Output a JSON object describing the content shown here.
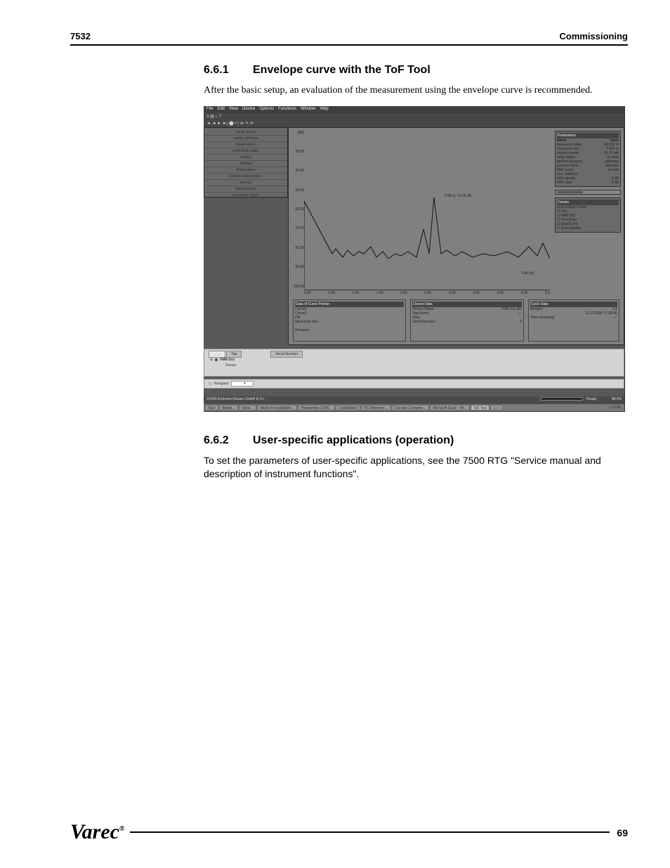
{
  "header": {
    "left": "7532",
    "right": "Commissioning"
  },
  "section1": {
    "num": "6.6.1",
    "title": "Envelope curve with the ToF Tool",
    "body": "After the basic setup, an evaluation of the measurement using the envelope curve is recommended."
  },
  "figure": {
    "menu": [
      "File",
      "Edit",
      "View",
      "Device",
      "Options",
      "Functions",
      "Window",
      "Help"
    ],
    "toolbar_icons": "≡ ▤ ⌂ ?",
    "toolbar2_icons": "◄ ◄ ► ►| ⬤ • | ≫ ✎ ⟳",
    "sidebar": [
      "basic setup",
      "safety settings",
      "linearisation",
      "extended calibr.",
      "output",
      "display",
      "diagnostics",
      "system parameters",
      "service",
      "linearization",
      "envelope curve"
    ],
    "y_ticks": [
      "[dB]",
      "20.00",
      "40.00",
      "50.00",
      "60.00",
      "70.00",
      "80.00",
      "90.00",
      "100.00"
    ],
    "x_ticks": [
      "0.00",
      "0.50",
      "1.00",
      "1.50",
      "2.00",
      "2.50",
      "3.00",
      "3.50",
      "4.00",
      "4.50",
      "5.0"
    ],
    "x_unit": "Dist [m]",
    "annotation": "2.96 m, 70.05 dB",
    "params_title": "Parameters",
    "params_name_col": "Name",
    "params_value_col": "Value",
    "params": [
      {
        "k": "measured value",
        "v": "59.636 %"
      },
      {
        "k": "measured dist.",
        "v": "2.963 m"
      },
      {
        "k": "output current",
        "v": "10.70 mA"
      },
      {
        "k": "noise figure",
        "v": "no data"
      },
      {
        "k": "tankbot property",
        "v": "unknown"
      },
      {
        "k": "process cond.",
        "v": "standard"
      },
      {
        "k": "FAC range",
        "v": "oil tank"
      },
      {
        "k": "env. statistics",
        "v": ""
      },
      {
        "k": "echo quality",
        "v": "8 dB"
      },
      {
        "k": "FAC state",
        "v": "3 dB"
      }
    ],
    "curves_title": "Curves",
    "curves": [
      "Envelope Curve",
      "FAC",
      "MAP Old",
      "First Echo",
      "Ideal Echo",
      "Echo Quality"
    ],
    "readcurve_title": "Data of Curve Pointer",
    "readcurve": [
      {
        "k": "Curve0:",
        "v": ""
      },
      {
        "k": "Curve3:",
        "v": ""
      },
      {
        "k": "DB:",
        "v": ""
      },
      {
        "k": "Ideal echo dist.:",
        "v": ""
      }
    ],
    "readcurve_footer": "Remarks:",
    "device_title": "Device Data",
    "device": [
      {
        "k": "Device-Name:",
        "v": "FMR-2xx DE"
      },
      {
        "k": "Tag-Name:",
        "v": "—"
      },
      {
        "k": "Note:",
        "v": ""
      },
      {
        "k": "Serial-Number:",
        "v": "0"
      }
    ],
    "cycle_title": "Cycle Data",
    "cycle": [
      {
        "k": "Number:",
        "v": "1/1"
      },
      {
        "k": "",
        "v": "11.10.2000 17:30:56"
      },
      {
        "k": "Time remaining:",
        "v": "—"
      }
    ],
    "subwin_tabs": [
      "……",
      "Tag",
      "Serial-Number"
    ],
    "subwin_device": "FMR-2xx",
    "subwin_device_sub": "Device",
    "navigator_label": "Navigator",
    "status_left": "©2000 Endress+Hauser GmbH & Co.",
    "status_right_ready": "Ready",
    "status_right_pct": "98.3%",
    "taskbar": [
      "Start",
      "Adobe…",
      "Inbox…",
      "Adobe FrameMaker…",
      "Parametrier-COM…",
      "ComEMail-0",
      "PC-Welcome…",
      "Console Zocheme…",
      "Microsoft Excel - Inf…",
      "ToF Tool",
      "——"
    ],
    "taskbar_time": "17:31"
  },
  "section2": {
    "num": "6.6.2",
    "title": "User-specific applications (operation)",
    "body": "To set the parameters of user-specific applications, see the 7500 RTG \"Service manual and description of instrument functions\"."
  },
  "footer": {
    "logo": "Varec",
    "page": "69"
  }
}
